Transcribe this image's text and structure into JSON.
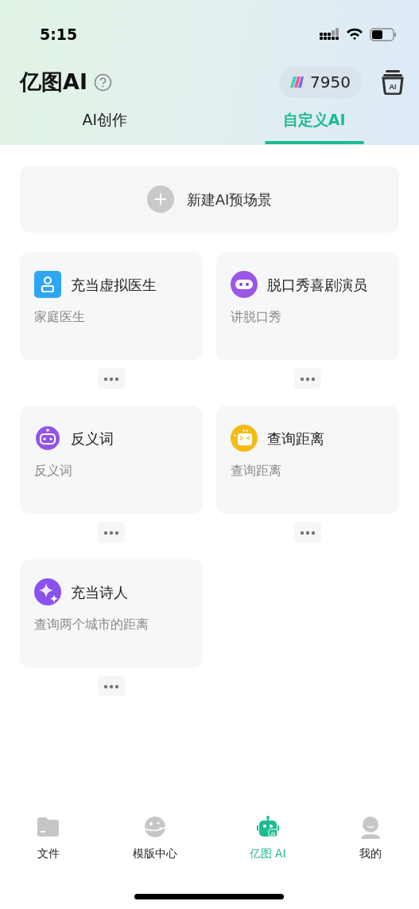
{
  "status_bar": {
    "time": "5:15"
  },
  "header": {
    "title": "亿图AI",
    "points": "7950",
    "toolbox_label": "AI"
  },
  "tabs": [
    {
      "label": "AI创作",
      "selected": false
    },
    {
      "label": "自定义AI",
      "selected": true
    }
  ],
  "new_scene": {
    "label": "新建AI预场景"
  },
  "scenes": [
    {
      "title": "充当虚拟医生",
      "subtitle": "家庭医生"
    },
    {
      "title": "脱口秀喜剧演员",
      "subtitle": "讲脱口秀"
    },
    {
      "title": "反义词",
      "subtitle": "反义词"
    },
    {
      "title": "查询距离",
      "subtitle": "查询距离"
    },
    {
      "title": "充当诗人",
      "subtitle": "查询两个城市的距离"
    }
  ],
  "bottom_nav": [
    {
      "label": "文件",
      "selected": false
    },
    {
      "label": "模版中心",
      "selected": false
    },
    {
      "label": "亿图 AI",
      "selected": true,
      "badge": "AI"
    },
    {
      "label": "我的",
      "selected": false
    }
  ]
}
